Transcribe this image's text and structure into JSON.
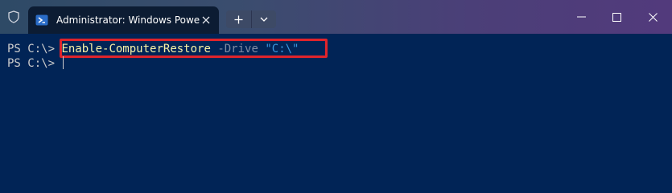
{
  "window": {
    "tab_title": "Administrator: Windows Powe",
    "background_color": "#012456",
    "accent_highlight_color": "#e0242b"
  },
  "titlebar": {
    "icons": [
      "shield-icon",
      "powershell-icon",
      "close-icon",
      "plus-icon",
      "chevron-down-icon",
      "minimize-icon",
      "maximize-icon",
      "close-icon"
    ]
  },
  "terminal": {
    "lines": [
      {
        "prompt": "PS C:\\>",
        "command": "Enable-ComputerRestore",
        "parameter": "-Drive",
        "argument": "\"C:\\\""
      },
      {
        "prompt": "PS C:\\>"
      }
    ]
  }
}
